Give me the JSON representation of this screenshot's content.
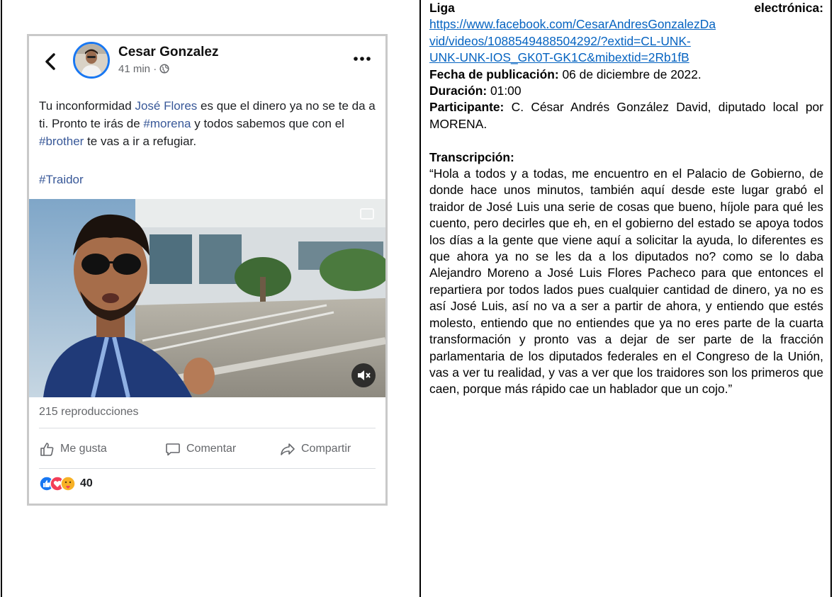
{
  "post": {
    "author": "Cesar Gonzalez",
    "time": "41 min · ",
    "text_1": "Tu inconformidad ",
    "mention": "José Flores",
    "text_2": " es que el dinero ya no se te da a ti. Pronto te irás de ",
    "hashtag_1": "#morena",
    "text_3": " y todos sabemos que con el ",
    "hashtag_2": "#brother",
    "text_4": " te vas a ir a refugiar.",
    "hashtag_3": "#Traidor",
    "views": "215 reproducciones",
    "like_label": "Me gusta",
    "comment_label": "Comentar",
    "share_label": "Compartir",
    "reaction_count": "40"
  },
  "icons": {
    "back": "chevron-left-icon",
    "more": "more-horizontal-icon",
    "privacy": "globe-icon",
    "mute": "speaker-muted-icon",
    "like": "thumbs-up-icon",
    "comment": "comment-bubble-icon",
    "share": "share-arrow-icon",
    "reactions": [
      "like-reaction-icon",
      "love-reaction-icon",
      "care-reaction-icon"
    ]
  },
  "colors": {
    "facebook_blue": "#1877f2",
    "link_blue": "#385898",
    "doc_link": "#0563c1",
    "meta_gray": "#65676b"
  },
  "doc": {
    "liga_label_1": "Liga",
    "liga_label_2": "electrónica:",
    "url_line_1": "https://www.facebook.com/CesarAndresGonzalezDa",
    "url_line_2": "vid/videos/1088549488504292/?extid=CL-UNK-",
    "url_line_3": "UNK-UNK-IOS_GK0T-GK1C&mibextid=2Rb1fB",
    "fecha_label": "Fecha de publicación:",
    "fecha_value": " 06 de diciembre de 2022.",
    "duracion_label": "Duración:",
    "duracion_value": " 01:00",
    "participante_label": "Participante:",
    "participante_value": " C. César Andrés González David, diputado local por MORENA.",
    "transcripcion_label": "Transcripción:",
    "transcripcion_text": "“Hola a todos y a todas, me encuentro en el Palacio de Gobierno, de donde hace unos minutos, también aquí desde este lugar grabó el traidor de  José Luis una serie de cosas que bueno, híjole para qué les cuento, pero decirles que eh, en el gobierno del estado se apoya todos los días a la gente que viene aquí a solicitar la ayuda, lo diferentes es que ahora ya no se les da a los diputados no? como se lo daba Alejandro Moreno a José Luis Flores Pacheco para que entonces el repartiera por todos lados pues cualquier cantidad de dinero, ya no es así José Luis, así no va a ser a partir de ahora, y entiendo que estés molesto, entiendo que no entiendes que ya no eres parte de la cuarta transformación y pronto vas a dejar de ser parte de la fracción parlamentaria de los diputados federales en el Congreso de la Unión, vas a ver tu realidad, y vas a ver que los traidores son los primeros que caen, porque más rápido cae un hablador que un cojo.”"
  }
}
